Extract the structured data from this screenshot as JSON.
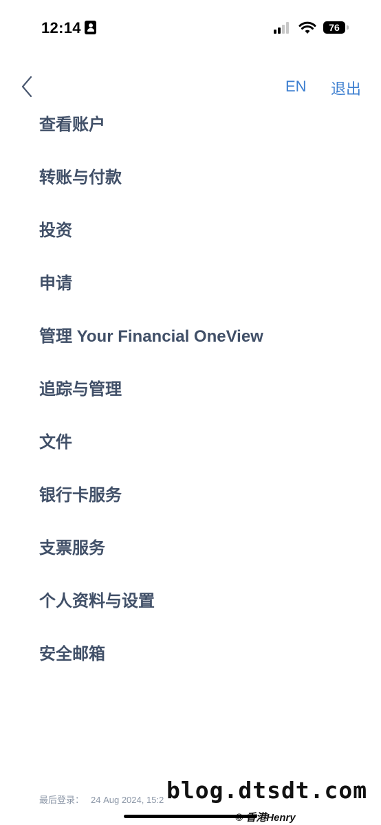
{
  "status_bar": {
    "time": "12:14",
    "battery": "76"
  },
  "header": {
    "language": "EN",
    "logout": "退出"
  },
  "menu": {
    "items": [
      {
        "label": "查看账户"
      },
      {
        "label": "转账与付款"
      },
      {
        "label": "投资"
      },
      {
        "label": "申请"
      },
      {
        "label": "管理 Your Financial OneView"
      },
      {
        "label": "追踪与管理"
      },
      {
        "label": "文件"
      },
      {
        "label": "银行卡服务"
      },
      {
        "label": "支票服务"
      },
      {
        "label": "个人资料与设置"
      },
      {
        "label": "安全邮箱"
      }
    ]
  },
  "footer": {
    "last_login_label": "最后登录：",
    "last_login_value": "24 Aug 2024, 15:2"
  },
  "watermark": {
    "main": "blog.dtsdt.com",
    "sub": "© 香港Henry"
  },
  "colors": {
    "accent": "#3d7fd0",
    "menu_text": "#415068",
    "muted_text": "#8c97a7",
    "background": "#ffffff"
  }
}
